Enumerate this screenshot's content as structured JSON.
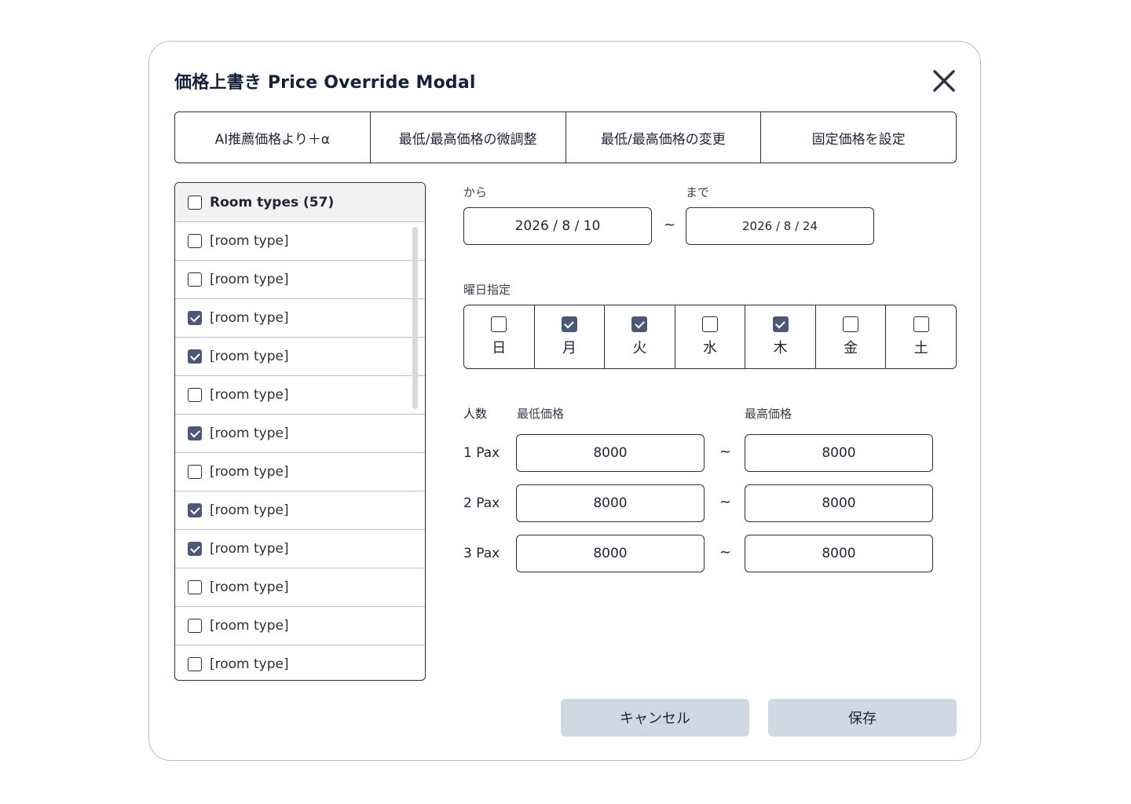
{
  "modal": {
    "title": "価格上書き Price Override Modal"
  },
  "tabs": [
    {
      "label": "AI推薦価格より＋α"
    },
    {
      "label": "最低/最高価格の微調整"
    },
    {
      "label": "最低/最高価格の変更"
    },
    {
      "label": "固定価格を設定"
    }
  ],
  "room_list": {
    "header": "Room types (57)",
    "header_checked": false,
    "items": [
      {
        "label": "[room type]",
        "checked": false
      },
      {
        "label": "[room type]",
        "checked": false
      },
      {
        "label": "[room type]",
        "checked": true
      },
      {
        "label": "[room type]",
        "checked": true
      },
      {
        "label": "[room type]",
        "checked": false
      },
      {
        "label": "[room type]",
        "checked": true
      },
      {
        "label": "[room type]",
        "checked": false
      },
      {
        "label": "[room type]",
        "checked": true
      },
      {
        "label": "[room type]",
        "checked": true
      },
      {
        "label": "[room type]",
        "checked": false
      },
      {
        "label": "[room type]",
        "checked": false
      },
      {
        "label": "[room type]",
        "checked": false
      }
    ]
  },
  "date_range": {
    "from_label": "から",
    "to_label": "まで",
    "from_value": "2026 / 8 / 10",
    "to_value": "2026 / 8 / 24",
    "separator": "~"
  },
  "weekdays": {
    "label": "曜日指定",
    "days": [
      {
        "label": "日",
        "checked": false
      },
      {
        "label": "月",
        "checked": true
      },
      {
        "label": "火",
        "checked": true
      },
      {
        "label": "水",
        "checked": false
      },
      {
        "label": "木",
        "checked": true
      },
      {
        "label": "金",
        "checked": false
      },
      {
        "label": "土",
        "checked": false
      }
    ]
  },
  "pricing": {
    "pax_header": "人数",
    "min_header": "最低価格",
    "max_header": "最高価格",
    "separator": "~",
    "rows": [
      {
        "pax": "1 Pax",
        "min": "8000",
        "max": "8000"
      },
      {
        "pax": "2 Pax",
        "min": "8000",
        "max": "8000"
      },
      {
        "pax": "3 Pax",
        "min": "8000",
        "max": "8000"
      }
    ]
  },
  "footer": {
    "cancel_label": "キャンセル",
    "save_label": "保存"
  },
  "colors": {
    "checkbox_checked": "#4b5878",
    "button_bg": "#cfd9e4",
    "title_color": "#15213b"
  }
}
